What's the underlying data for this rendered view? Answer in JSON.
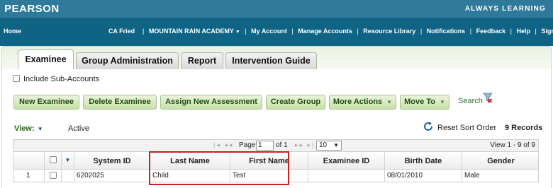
{
  "brand": {
    "logo": "PEARSON",
    "tagline": "ALWAYS LEARNING"
  },
  "nav": {
    "home": "Home",
    "user": "CA Fried",
    "links": [
      "MOUNTAIN RAIN ACADEMY",
      "My Account",
      "Manage Accounts",
      "Resource Library",
      "Notifications",
      "Feedback",
      "Help",
      "Sign Out"
    ]
  },
  "tabs": [
    "Examinee",
    "Group Administration",
    "Report",
    "Intervention Guide"
  ],
  "subaccounts_label": "Include Sub-Accounts",
  "buttons": {
    "new_examinee": "New Examinee",
    "delete_examinee": "Delete Examinee",
    "assign": "Assign New Assessment",
    "create_group": "Create Group",
    "more_actions": "More Actions",
    "move_to": "Move To"
  },
  "search_label": "Search",
  "view_label": "View:",
  "view_value": "Active",
  "reset_sort": "Reset Sort Order",
  "records": "9 Records",
  "pager": {
    "page_label": "Page",
    "page_value": "1",
    "of_label": "of 1",
    "page_size": "10",
    "view_count": "View 1 - 9 of 9"
  },
  "columns": [
    "",
    "",
    "",
    "System ID",
    "Last Name",
    "First Name",
    "Examinee ID",
    "Birth Date",
    "Gender"
  ],
  "rows": [
    [
      "1",
      "",
      "",
      "6202025",
      "Child",
      "Test",
      "",
      "08/01/2010",
      "Male"
    ]
  ],
  "colors": {
    "brand_bar": "#2f7a9a",
    "nav_bar": "#0f6384",
    "button_text": "#1e4f12",
    "highlight": "#cc1f1f"
  },
  "icons": [
    "dropdown-caret-icon",
    "checkbox-icon",
    "search-clear-icon",
    "refresh-icon",
    "pager-arrows-icon"
  ]
}
